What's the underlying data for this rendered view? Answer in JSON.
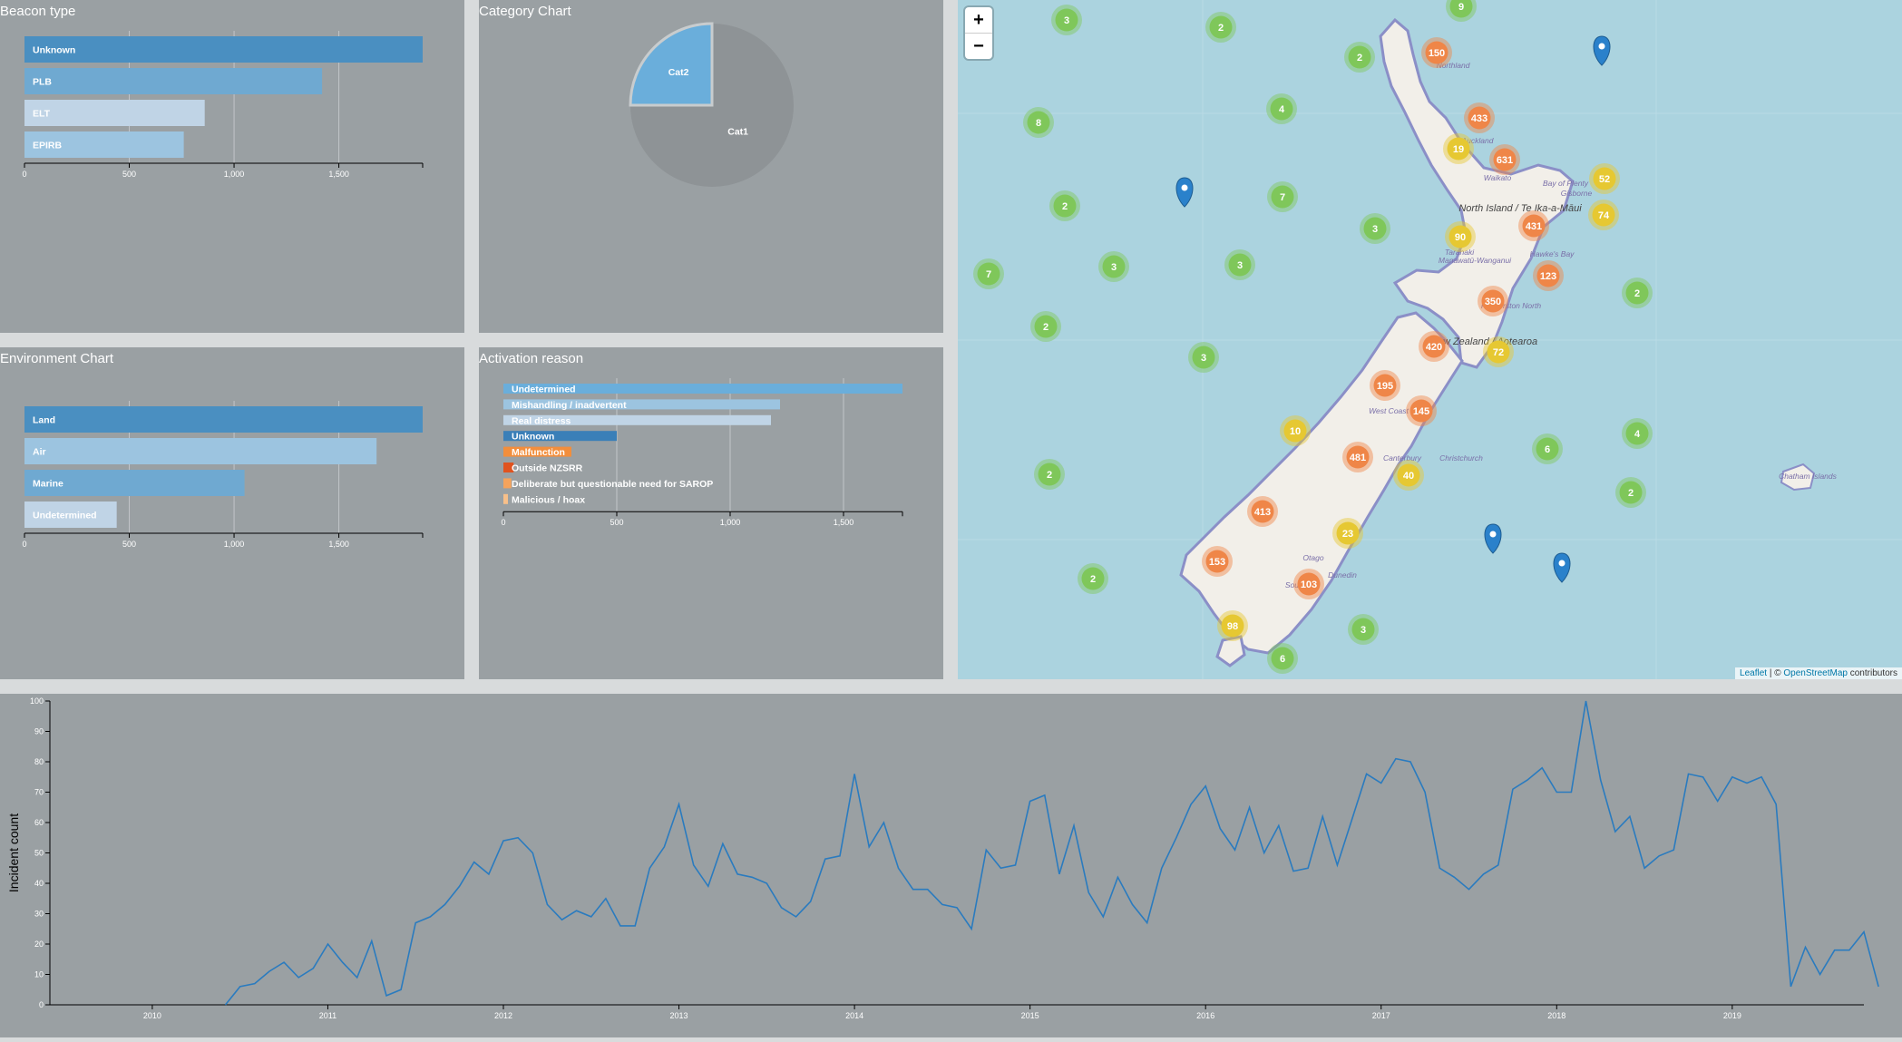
{
  "beacon_type": {
    "title": "Beacon type",
    "chart_data": {
      "type": "bar",
      "orientation": "horizontal",
      "categories": [
        "Unknown",
        "PLB",
        "ELT",
        "EPIRB"
      ],
      "values": [
        1900,
        1420,
        860,
        760
      ],
      "colors": [
        "#4a8fc1",
        "#6fa9d1",
        "#c0d4e6",
        "#9cc4e0"
      ],
      "xlim": [
        0,
        1900
      ],
      "xticks": [
        0,
        500,
        1000,
        1500
      ],
      "xtick_labels": [
        "0",
        "500",
        "1,000",
        "1,500"
      ]
    }
  },
  "category_chart": {
    "title": "Category Chart",
    "chart_data": {
      "type": "pie",
      "slices": [
        {
          "label": "Cat1",
          "value": 75,
          "color": "#8e9396"
        },
        {
          "label": "Cat2",
          "value": 25,
          "color": "#6aaedb"
        }
      ]
    }
  },
  "environment_chart": {
    "title": "Environment Chart",
    "chart_data": {
      "type": "bar",
      "orientation": "horizontal",
      "categories": [
        "Land",
        "Air",
        "Marine",
        "Undetermined"
      ],
      "values": [
        1900,
        1680,
        1050,
        440
      ],
      "colors": [
        "#4a8fc1",
        "#9cc4e0",
        "#6fa9d1",
        "#c0d4e6"
      ],
      "xlim": [
        0,
        1900
      ],
      "xticks": [
        0,
        500,
        1000,
        1500
      ],
      "xtick_labels": [
        "0",
        "500",
        "1,000",
        "1,500"
      ]
    }
  },
  "activation_reason": {
    "title": "Activation reason",
    "chart_data": {
      "type": "bar",
      "orientation": "horizontal",
      "categories": [
        "Undetermined",
        "Mishandling / inadvertent",
        "Real distress",
        "Unknown",
        "Malfunction",
        "Outside NZSRR",
        "Deliberate but questionable need for SAROP",
        "Malicious / hoax"
      ],
      "values": [
        1760,
        1220,
        1180,
        500,
        300,
        45,
        35,
        20
      ],
      "colors": [
        "#6aaedb",
        "#9cc4e0",
        "#c0d4e6",
        "#3a7fb8",
        "#f28e3c",
        "#e0531f",
        "#f5a35c",
        "#f8c08a"
      ],
      "xlim": [
        0,
        1760
      ],
      "xticks": [
        0,
        500,
        1000,
        1500
      ],
      "xtick_labels": [
        "0",
        "500",
        "1,000",
        "1,500"
      ]
    }
  },
  "map": {
    "zoom_in": "+",
    "zoom_out": "−",
    "attribution_leaflet": "Leaflet",
    "attribution_sep": " | © ",
    "attribution_osm": "OpenStreetMap",
    "attribution_tail": " contributors",
    "place_labels": [
      "Northland",
      "Auckland",
      "Waikato",
      "Bay of Plenty",
      "Gisborne",
      "North Island / Te Ika-a-Māui",
      "Taranaki",
      "Manawatū-Wanganui",
      "Hawke's Bay",
      "Palmerston North",
      "New Zealand / Aotearoa",
      "West Coast",
      "Canterbury",
      "Christchurch",
      "Otago",
      "Dunedin",
      "Southland",
      "Chatham Islands"
    ],
    "colors": {
      "small": "#7fc75a",
      "medium": "#e6c832",
      "large": "#ef8648",
      "marker": "#2a81cb"
    },
    "clusters": [
      {
        "count": "3",
        "size": "small"
      },
      {
        "count": "2",
        "size": "small"
      },
      {
        "count": "9",
        "size": "small"
      },
      {
        "count": "2",
        "size": "small"
      },
      {
        "count": "150",
        "size": "large"
      },
      {
        "count": "433",
        "size": "large"
      },
      {
        "count": "4",
        "size": "small"
      },
      {
        "count": "8",
        "size": "small"
      },
      {
        "count": "19",
        "size": "medium"
      },
      {
        "count": "631",
        "size": "large"
      },
      {
        "count": "52",
        "size": "medium"
      },
      {
        "count": "7",
        "size": "small"
      },
      {
        "count": "2",
        "size": "small"
      },
      {
        "count": "3",
        "size": "small"
      },
      {
        "count": "431",
        "size": "large"
      },
      {
        "count": "74",
        "size": "medium"
      },
      {
        "count": "90",
        "size": "medium"
      },
      {
        "count": "7",
        "size": "small"
      },
      {
        "count": "3",
        "size": "small"
      },
      {
        "count": "3",
        "size": "small"
      },
      {
        "count": "123",
        "size": "large"
      },
      {
        "count": "2",
        "size": "small"
      },
      {
        "count": "350",
        "size": "large"
      },
      {
        "count": "2",
        "size": "small"
      },
      {
        "count": "3",
        "size": "small"
      },
      {
        "count": "420",
        "size": "large"
      },
      {
        "count": "72",
        "size": "medium"
      },
      {
        "count": "195",
        "size": "large"
      },
      {
        "count": "145",
        "size": "large"
      },
      {
        "count": "10",
        "size": "medium"
      },
      {
        "count": "6",
        "size": "small"
      },
      {
        "count": "4",
        "size": "small"
      },
      {
        "count": "481",
        "size": "large"
      },
      {
        "count": "40",
        "size": "medium"
      },
      {
        "count": "2",
        "size": "small"
      },
      {
        "count": "2",
        "size": "small"
      },
      {
        "count": "413",
        "size": "large"
      },
      {
        "count": "23",
        "size": "medium"
      },
      {
        "count": "153",
        "size": "large"
      },
      {
        "count": "103",
        "size": "large"
      },
      {
        "count": "2",
        "size": "small"
      },
      {
        "count": "98",
        "size": "medium"
      },
      {
        "count": "3",
        "size": "small"
      },
      {
        "count": "6",
        "size": "small"
      }
    ]
  },
  "incident_timeline": {
    "chart_data": {
      "type": "line",
      "ylabel": "Incident count",
      "ylim": [
        0,
        100
      ],
      "yticks": [
        0,
        10,
        20,
        30,
        40,
        50,
        60,
        70,
        80,
        90,
        100
      ],
      "xlim": [
        "2009-06",
        "2019-10"
      ],
      "xticks": [
        "2010",
        "2011",
        "2012",
        "2013",
        "2014",
        "2015",
        "2016",
        "2017",
        "2018",
        "2019"
      ],
      "start_month": "2010-06",
      "values": [
        0,
        6,
        7,
        11,
        14,
        9,
        12,
        20,
        14,
        9,
        21,
        3,
        5,
        27,
        29,
        33,
        39,
        47,
        43,
        54,
        55,
        50,
        33,
        28,
        31,
        29,
        35,
        26,
        26,
        45,
        52,
        66,
        46,
        39,
        53,
        43,
        42,
        40,
        32,
        29,
        34,
        48,
        49,
        76,
        52,
        60,
        45,
        38,
        38,
        33,
        32,
        25,
        51,
        45,
        46,
        67,
        69,
        43,
        59,
        37,
        29,
        42,
        33,
        27,
        45,
        55,
        66,
        72,
        58,
        51,
        65,
        50,
        59,
        44,
        45,
        62,
        46,
        61,
        76,
        73,
        81,
        80,
        70,
        45,
        42,
        38,
        43,
        46,
        71,
        74,
        78,
        70,
        70,
        100,
        74,
        57,
        62,
        45,
        49,
        51,
        76,
        75,
        67,
        75,
        73,
        75,
        66,
        6,
        19,
        10,
        18,
        18,
        24,
        6
      ],
      "color": "#2a7bbf"
    }
  }
}
